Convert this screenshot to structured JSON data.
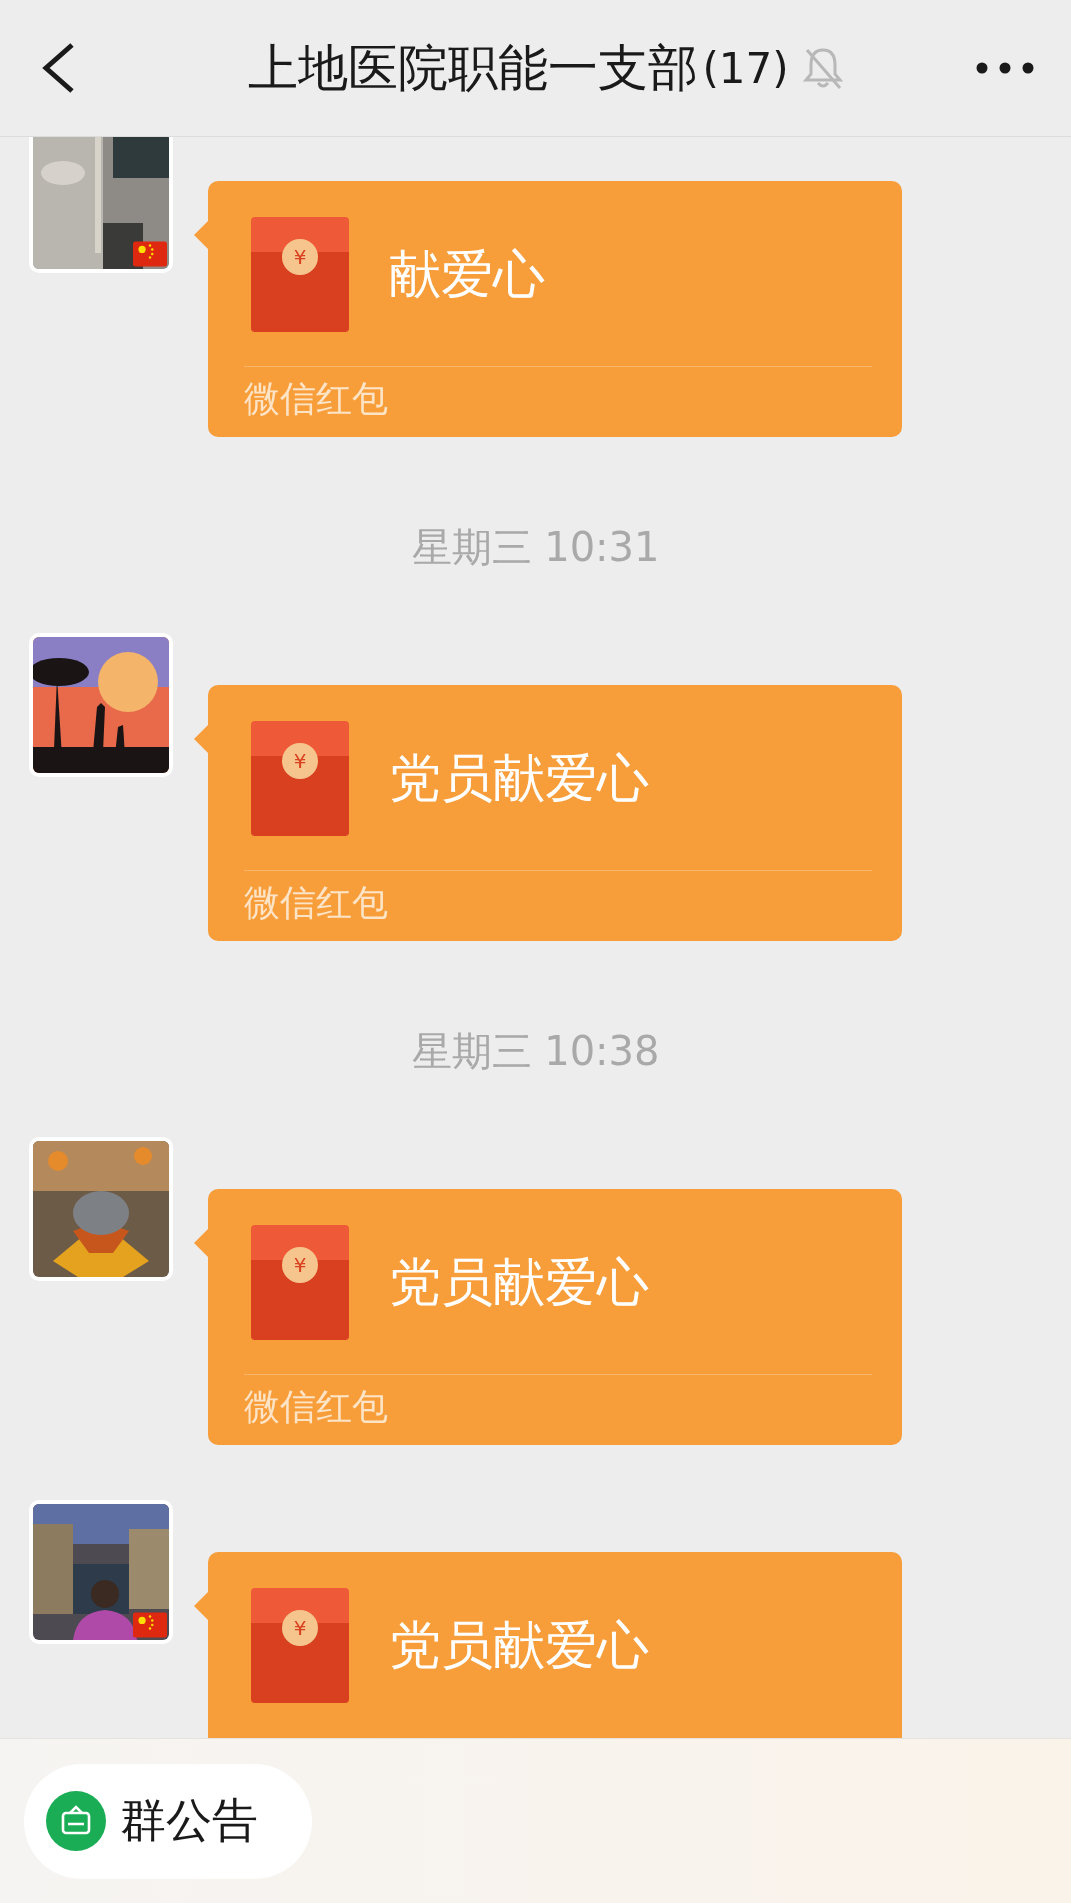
{
  "header": {
    "title": "上地医院职能一支部",
    "count": "(17)",
    "muted": true
  },
  "messages": [
    {
      "kind": "envelope",
      "flag": true,
      "symbol": "¥",
      "text": "献爱心",
      "label": "微信红包"
    },
    {
      "kind": "time",
      "text": "星期三 10:31"
    },
    {
      "kind": "envelope",
      "flag": false,
      "symbol": "¥",
      "text": "党员献爱心",
      "label": "微信红包"
    },
    {
      "kind": "time",
      "text": "星期三 10:38"
    },
    {
      "kind": "envelope",
      "flag": false,
      "symbol": "¥",
      "text": "党员献爱心",
      "label": "微信红包"
    },
    {
      "kind": "envelope",
      "flag": true,
      "symbol": "¥",
      "text": "党员献爱心"
    }
  ],
  "announcement": {
    "label": "群公告"
  }
}
